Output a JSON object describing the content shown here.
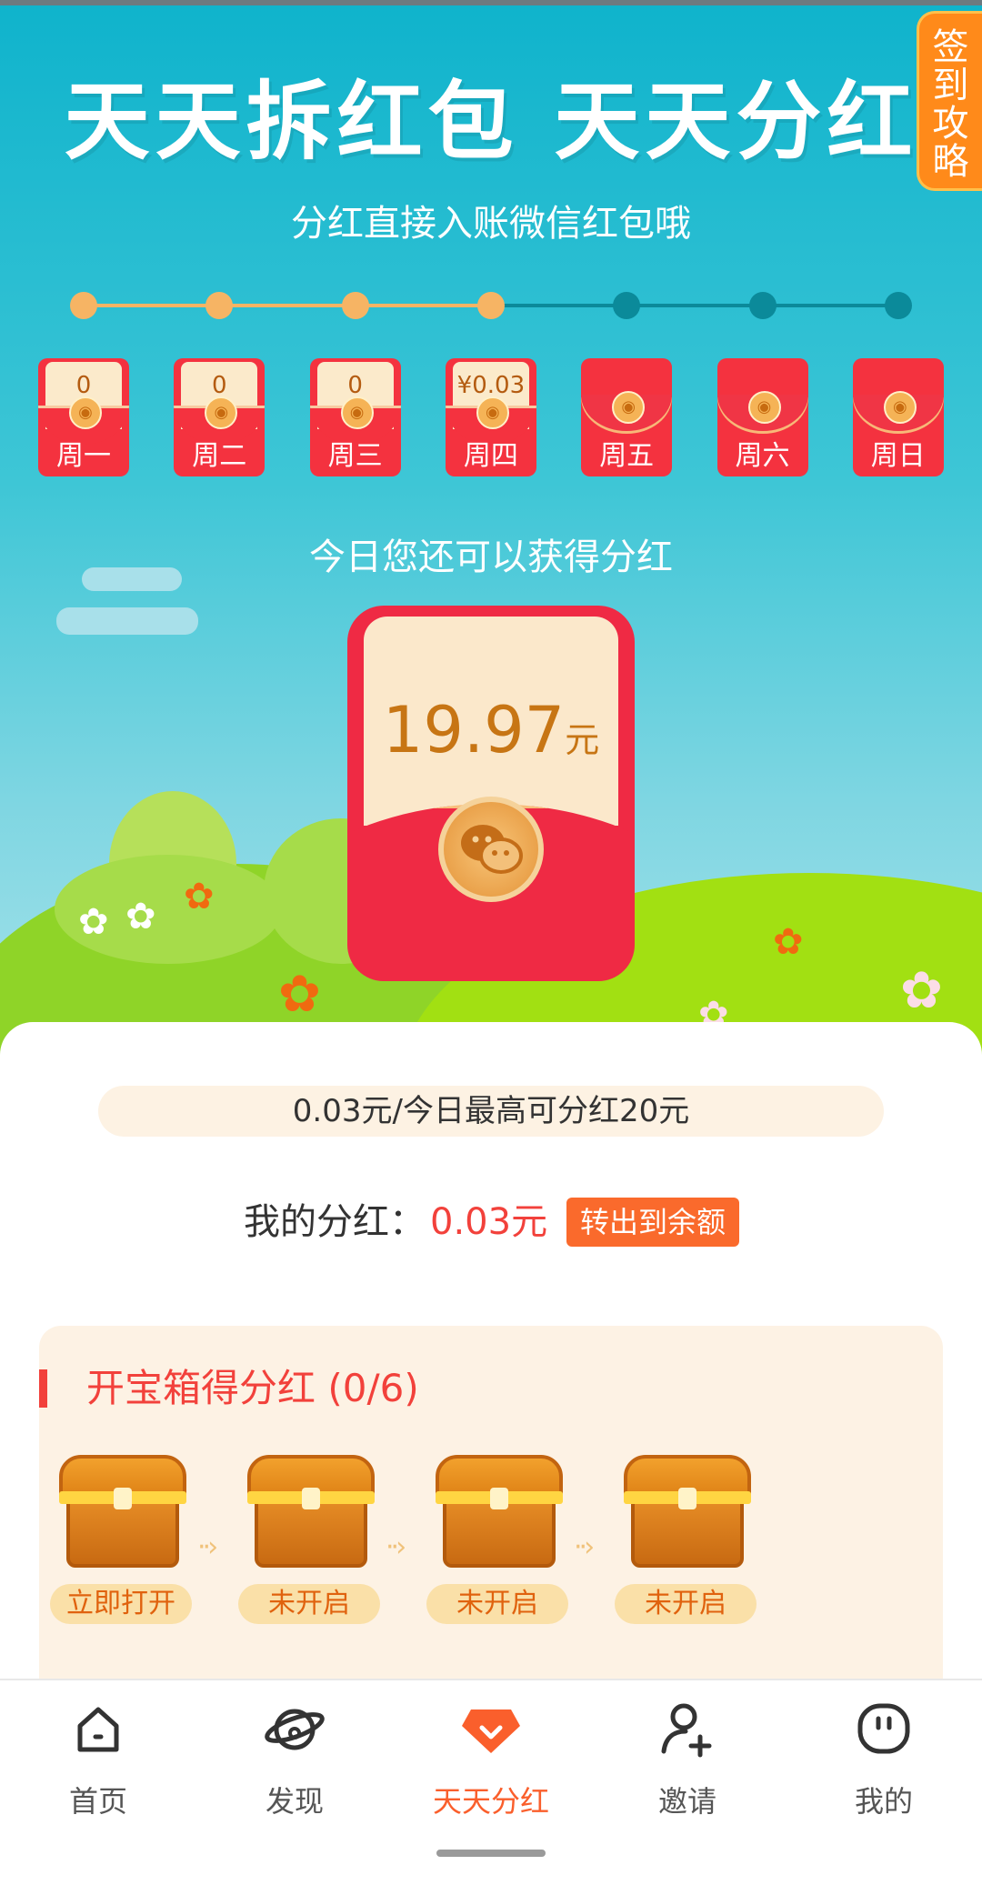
{
  "header": {
    "title": "天天拆红包  天天分红",
    "subtitle": "分红直接入账微信红包哦",
    "guide_label": [
      "签",
      "到",
      "攻",
      "略"
    ]
  },
  "week": {
    "days": [
      {
        "label": "周一",
        "value": "0",
        "opened": true
      },
      {
        "label": "周二",
        "value": "0",
        "opened": true
      },
      {
        "label": "周三",
        "value": "0",
        "opened": true
      },
      {
        "label": "周四",
        "value": "¥0.03",
        "opened": true
      },
      {
        "label": "周五",
        "value": "",
        "opened": false
      },
      {
        "label": "周六",
        "value": "",
        "opened": false
      },
      {
        "label": "周日",
        "value": "",
        "opened": false
      }
    ],
    "completed_days": 4,
    "colors": {
      "done": "#f6b464",
      "pending": "#0b8a9a"
    }
  },
  "today": {
    "label": "今日您还可以获得分红",
    "amount": "19.97",
    "unit": "元"
  },
  "info": {
    "rate_text": "0.03元/今日最高可分红20元",
    "my_bonus_label": "我的分红：",
    "my_bonus_value": "0.03元",
    "transfer_button": "转出到余额"
  },
  "chests": {
    "title": "开宝箱得分红 (0/6)",
    "items": [
      {
        "label": "立即打开"
      },
      {
        "label": "未开启"
      },
      {
        "label": "未开启"
      },
      {
        "label": "未开启"
      }
    ]
  },
  "tabbar": {
    "items": [
      {
        "label": "首页",
        "icon": "home-icon",
        "active": false
      },
      {
        "label": "发现",
        "icon": "discover-icon",
        "active": false
      },
      {
        "label": "天天分红",
        "icon": "bonus-icon",
        "active": true
      },
      {
        "label": "邀请",
        "icon": "invite-icon",
        "active": false
      },
      {
        "label": "我的",
        "icon": "profile-icon",
        "active": false
      }
    ],
    "accent": "#fa5f2c"
  }
}
